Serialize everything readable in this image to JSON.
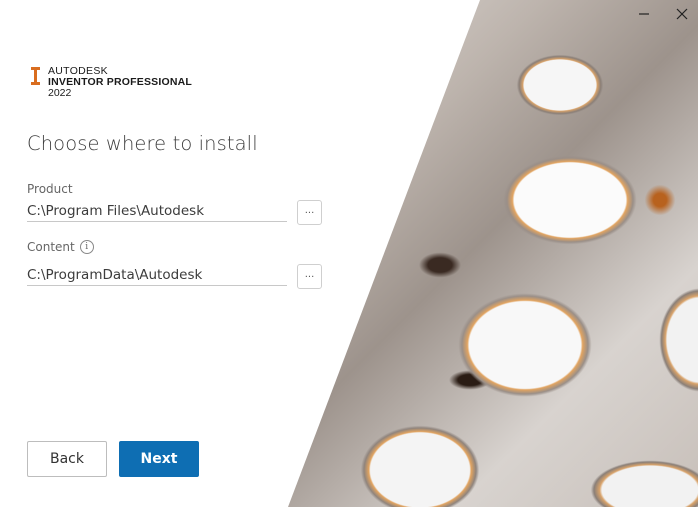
{
  "window": {
    "minimize_label": "Minimize",
    "close_label": "Close"
  },
  "logo": {
    "brand": "AUTODESK",
    "product": "INVENTOR PROFESSIONAL",
    "year": "2022",
    "mark_color": "#d96d1f"
  },
  "page": {
    "title": "Choose where to install"
  },
  "fields": {
    "product": {
      "label": "Product",
      "value": "C:\\Program Files\\Autodesk",
      "browse_label": "..."
    },
    "content": {
      "label": "Content",
      "info_icon": "i",
      "value": "C:\\ProgramData\\Autodesk",
      "browse_label": "..."
    }
  },
  "buttons": {
    "back": "Back",
    "next": "Next"
  },
  "colors": {
    "primary": "#0e6eb3",
    "accent": "#d96d1f"
  }
}
